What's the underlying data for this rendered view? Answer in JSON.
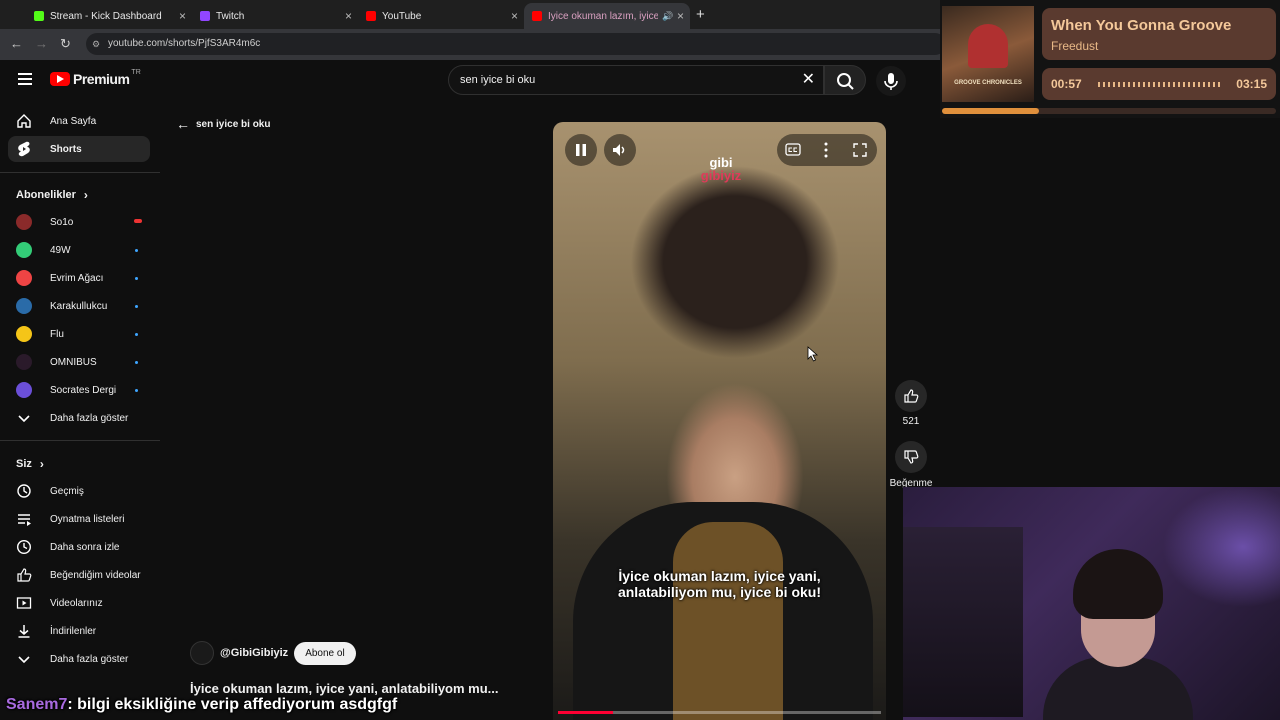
{
  "browser": {
    "tabs": [
      {
        "label": "Stream - Kick Dashboard",
        "fav_color": "#53fc18"
      },
      {
        "label": "Twitch",
        "fav_color": "#9146ff"
      },
      {
        "label": "YouTube",
        "fav_color": "#ff0000"
      },
      {
        "label": "İyice okuman lazım, iyice ya",
        "fav_color": "#ff0000"
      }
    ],
    "new_tab": "+",
    "url": "youtube.com/shorts/PjfS3AR4m6c"
  },
  "header": {
    "logo": "Premium",
    "logo_region": "TR",
    "search_value": "sen iyice bi oku"
  },
  "back_label": "sen iyice bi oku",
  "sidebar": {
    "main": [
      {
        "label": "Ana Sayfa",
        "icon": "home-icon"
      },
      {
        "label": "Shorts",
        "icon": "shorts-icon"
      }
    ],
    "subs_title": "Abonelikler",
    "subs": [
      {
        "label": "So1o",
        "color": "#d33"
      },
      {
        "label": "49W",
        "color": "#3c7"
      },
      {
        "label": "Evrim Ağacı",
        "color": "#e44"
      },
      {
        "label": "Karakullukcu",
        "color": "#2a6ba8"
      },
      {
        "label": "Flu",
        "color": "#f5c518"
      },
      {
        "label": "OMNIBUS",
        "color": "#333"
      },
      {
        "label": "Socrates Dergi",
        "color": "#6b4fd8"
      }
    ],
    "subs_more": "Daha fazla göster",
    "you_title": "Siz",
    "you": [
      {
        "label": "Geçmiş",
        "icon": "history-icon"
      },
      {
        "label": "Oynatma listeleri",
        "icon": "playlist-icon"
      },
      {
        "label": "Daha sonra izle",
        "icon": "clock-icon"
      },
      {
        "label": "Beğendiğim videolar",
        "icon": "thumbs-up-icon"
      },
      {
        "label": "Videolarınız",
        "icon": "video-icon"
      },
      {
        "label": "İndirilenler",
        "icon": "download-icon"
      }
    ],
    "you_more": "Daha fazla göster"
  },
  "video": {
    "logo_line1": "gibi",
    "logo_line2": "gibiyiz",
    "subtitle_line1": "İyice okuman lazım, iyice yani,",
    "subtitle_line2": "anlatabiliyom mu, iyice bi oku!",
    "progress": 0.17,
    "channel": "@GibiGibiyiz",
    "subscribe": "Abone ol",
    "title": "İyice okuman lazım, iyice yani, anlatabiliyom mu..."
  },
  "actions": {
    "likes": "521",
    "dislike_label": "Beğenme"
  },
  "music": {
    "song": "When You Gonna Groove",
    "artist": "Freedust",
    "album_art_text": "GROOVE CHRONICLES",
    "elapsed": "00:57",
    "duration": "03:15",
    "progress": 0.29
  },
  "chat": {
    "user": "Sanem7",
    "message": ": bilgi eksikliğine verip affediyorum asdgfgf"
  }
}
